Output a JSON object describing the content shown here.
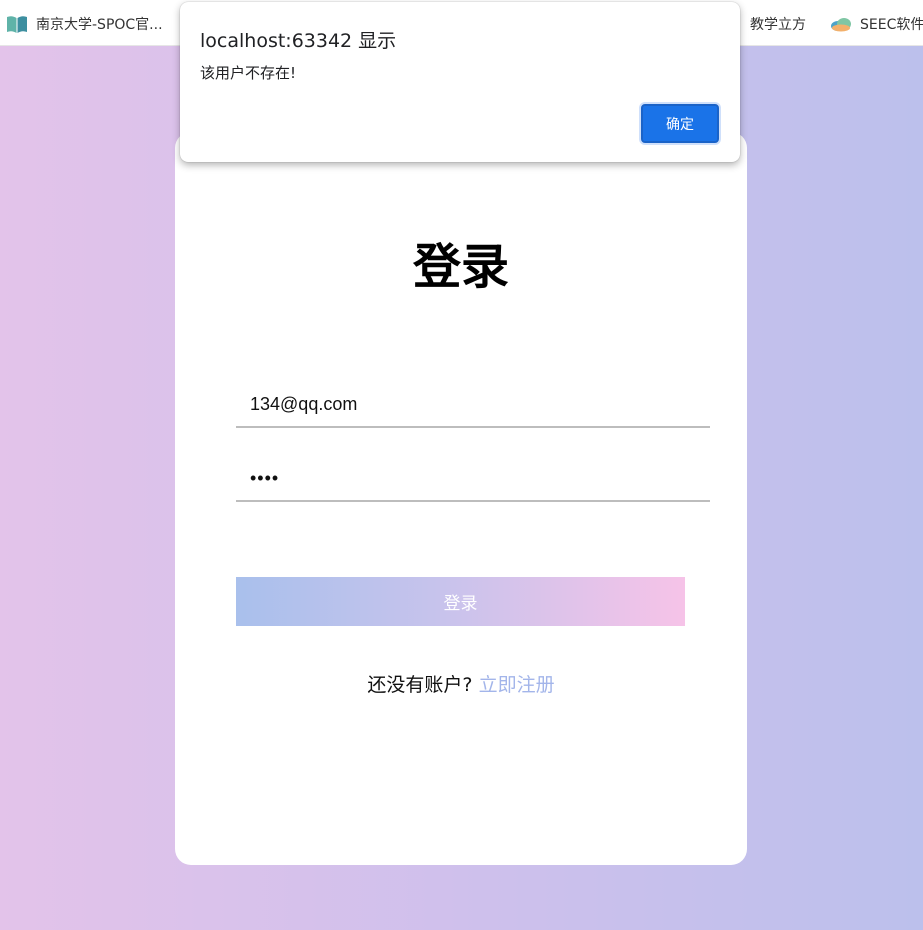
{
  "bookmarks": [
    {
      "label": "南京大学-SPOC官...",
      "icon": "book-icon"
    },
    {
      "label": "教学立方"
    },
    {
      "label": "SEEC软件",
      "icon": "cloud-icon"
    }
  ],
  "dialog": {
    "title": "localhost:63342 显示",
    "message": "该用户不存在!",
    "ok_label": "确定"
  },
  "login": {
    "title": "登录",
    "email_value": "134@qq.com",
    "password_mask": "••••",
    "submit_label": "登录",
    "register_prompt": "还没有账户?",
    "register_link": "立即注册"
  },
  "colors": {
    "dialog_button": "#1a73e8",
    "register_link": "#a3b5ea",
    "gradient_start": "#a9c0ec",
    "gradient_end": "#f6c3e8"
  }
}
